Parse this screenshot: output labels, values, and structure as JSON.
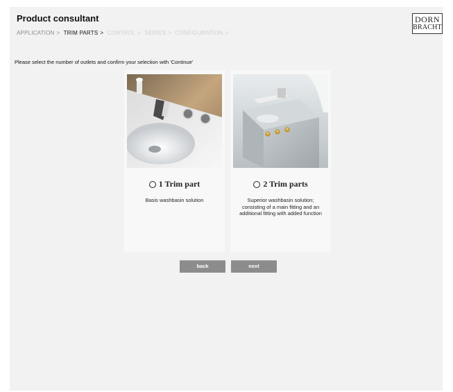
{
  "header": {
    "title": "Product consultant",
    "breadcrumb": [
      {
        "label": "APPLICATION",
        "state": "done"
      },
      {
        "label": "TRIM PARTS",
        "state": "active"
      },
      {
        "label": "CONTROL",
        "state": "todo"
      },
      {
        "label": "SERIES",
        "state": "todo"
      },
      {
        "label": "CONFIGURATION",
        "state": "todo"
      }
    ],
    "separator": ">",
    "logo_line1": "DORN",
    "logo_line2": "BRACHT"
  },
  "instruction": "Please select the number of outlets and confirm your selection with 'Continue'",
  "options": [
    {
      "title": "1 Trim part",
      "description": "Basis washbasin solution",
      "image": "basin-single-trim-photo",
      "selected": false
    },
    {
      "title": "2 Trim parts",
      "description": "Superior washbasin solution; consisting of a main fitting and an additional fitting with added function",
      "image": "basin-double-trim-photo",
      "selected": false
    }
  ],
  "buttons": {
    "back_label": "back",
    "next_label": "next"
  },
  "colors": {
    "panel_bg": "#f2f2f2",
    "button_bg": "#8c8c8c",
    "crumb_done": "#8a8a8a",
    "crumb_todo": "#cfcfcf"
  }
}
